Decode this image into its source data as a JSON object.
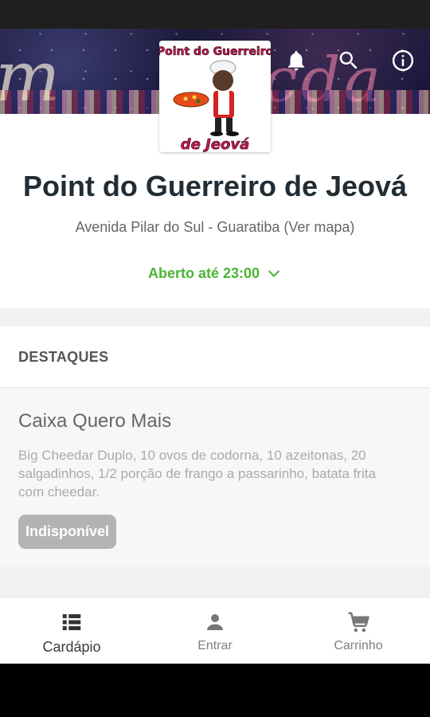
{
  "store": {
    "name": "Point do Guerreiro de Jeová",
    "address": "Avenida Pilar do Sul - Guaratiba (Ver mapa)",
    "open_status": "Aberto até 23:00"
  },
  "logo": {
    "top_text": "Point do Guerreiro",
    "bottom_text": "de Jeová"
  },
  "banner": {
    "icons": [
      "bell-icon",
      "search-icon",
      "info-icon"
    ]
  },
  "highlights": {
    "title": "DESTAQUES",
    "products": [
      {
        "name": "Caixa Quero Mais",
        "description": "Big Cheedar Duplo, 10 ovos de codorna, 10 azeitonas, 20 salgadinhos, 1/2 porção de frango a passarinho, batata frita com cheedar.",
        "status": "Indisponível"
      }
    ]
  },
  "bottom_nav": [
    {
      "label": "Cardápio",
      "icon": "menu-list-icon",
      "active": true
    },
    {
      "label": "Entrar",
      "icon": "person-icon",
      "active": false
    },
    {
      "label": "Carrinho",
      "icon": "cart-icon",
      "active": false
    }
  ],
  "colors": {
    "open_green": "#4cb533",
    "badge_gray": "#b3b3b3",
    "title_dark": "#222c33"
  }
}
